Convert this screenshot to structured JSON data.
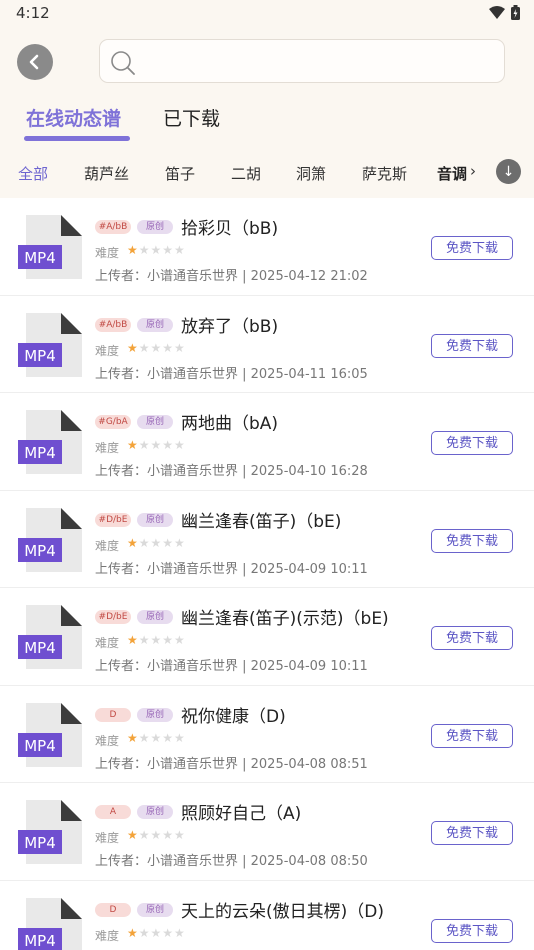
{
  "status": {
    "time": "4:12"
  },
  "search": {
    "placeholder": "",
    "value": ""
  },
  "tabs": [
    "在线动态谱",
    "已下载"
  ],
  "categories": [
    "全部",
    "葫芦丝",
    "笛子",
    "二胡",
    "洞箫",
    "萨克斯",
    "音调"
  ],
  "common": {
    "difficulty_label": "难度",
    "download_label": "免费下载",
    "file_type": "MP4",
    "original_badge": "原创",
    "stars": "★★★★★"
  },
  "songs": [
    {
      "key": "#A/bB",
      "title": "拾彩贝（bB)",
      "uploader_line": "上传者：小谱通音乐世界 | 2025-04-12 21:02"
    },
    {
      "key": "#A/bB",
      "title": "放弃了（bB)",
      "uploader_line": "上传者：小谱通音乐世界 | 2025-04-11 16:05"
    },
    {
      "key": "#G/bA",
      "title": "两地曲（bA)",
      "uploader_line": "上传者：小谱通音乐世界 | 2025-04-10 16:28"
    },
    {
      "key": "#D/bE",
      "title": "幽兰逢春(笛子)（bE)",
      "uploader_line": "上传者：小谱通音乐世界 | 2025-04-09 10:11"
    },
    {
      "key": "#D/bE",
      "title": "幽兰逢春(笛子)(示范)（bE)",
      "uploader_line": "上传者：小谱通音乐世界 | 2025-04-09 10:11"
    },
    {
      "key": "D",
      "title": "祝你健康（D)",
      "uploader_line": "上传者：小谱通音乐世界 | 2025-04-08 08:51"
    },
    {
      "key": "A",
      "title": "照顾好自己（A)",
      "uploader_line": "上传者：小谱通音乐世界 | 2025-04-08 08:50"
    },
    {
      "key": "D",
      "title": "天上的云朵(傲日其楞)（D)",
      "uploader_line": ""
    }
  ]
}
